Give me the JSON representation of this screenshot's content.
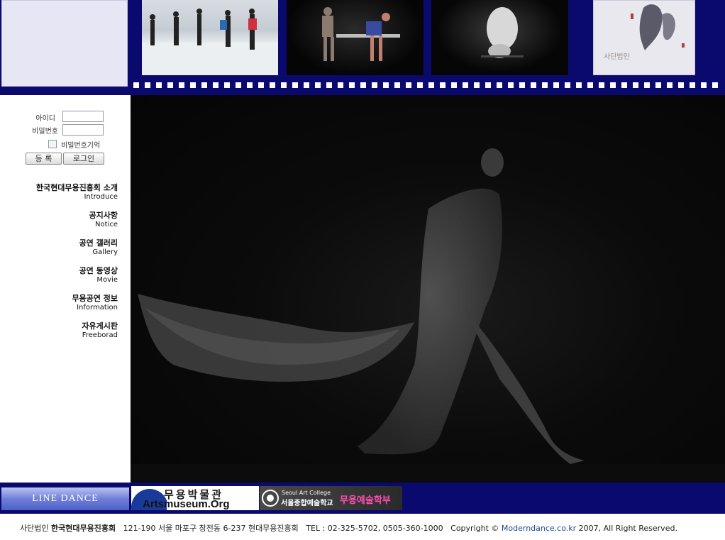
{
  "header": {
    "photo_4_caption": "사단법인"
  },
  "login": {
    "id_label": "아이디",
    "password_label": "비밀번호",
    "remember_label": "비밀번호기억",
    "register_button": "등 록",
    "login_button": "로그인"
  },
  "menu": [
    {
      "ko": "한국현대무용진흥회 소개",
      "en": "Introduce"
    },
    {
      "ko": "공지사항",
      "en": "Notice"
    },
    {
      "ko": "공연 갤러리",
      "en": "Gallery"
    },
    {
      "ko": "공연 동영상",
      "en": "Movie"
    },
    {
      "ko": "무용공연 정보",
      "en": "Information"
    },
    {
      "ko": "자유게시판",
      "en": "Freeborad"
    }
  ],
  "banners": {
    "line_dance": "LINE DANCE",
    "artsmuseum_ko": "무용박물관",
    "artsmuseum_en": "Artsmuseum.Org",
    "seoul_art_en": "Seoul Art College",
    "seoul_art_ko": "서울종합예술학교",
    "seoul_art_dept": "무용예술학부"
  },
  "footer": {
    "org_prefix": "사단법인",
    "org_name": "한국현대무용진흥회",
    "address": "121-190 서울 마포구 창전동 6-237 현대무용진흥회",
    "tel": "TEL : 02-325-5702, 0505-360-1000",
    "copyright": "Copyright ©",
    "site": "Moderndance.co.kr",
    "rights": "2007, All Right Reserved."
  },
  "colors": {
    "brand_navy": "#0a0a6e",
    "footer_link": "#1a4a8a",
    "banner_pink": "#ff4fb0"
  }
}
